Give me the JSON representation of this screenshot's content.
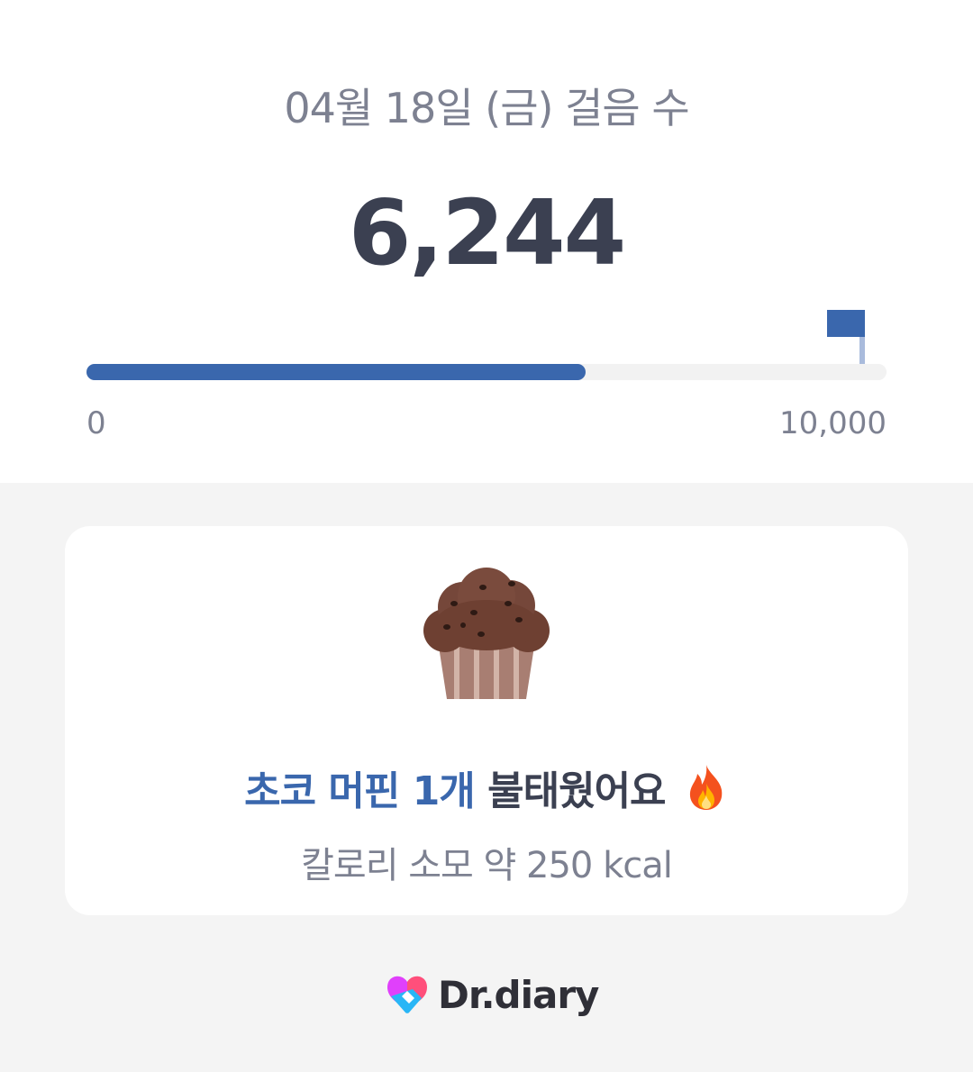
{
  "header": {
    "date_title": "04월 18일 (금) 걸음 수",
    "step_count": "6,244"
  },
  "progress": {
    "current": 6244,
    "goal": 10000,
    "min_label": "0",
    "max_label": "10,000",
    "fill_color": "#3a67ad",
    "track_color": "#f2f2f2"
  },
  "card": {
    "food_icon": "chocolate-muffin-icon",
    "burn_highlight": "초코 머핀 1개",
    "burn_suffix": "불태웠어요",
    "fire_icon": "fire-icon",
    "kcal_text": "칼로리 소모 약 250 kcal"
  },
  "footer": {
    "logo_text": "Dr.diary",
    "logo_icon": "heart-logo-icon"
  },
  "colors": {
    "accent": "#3a67ad",
    "text_dark": "#3b4051",
    "text_muted": "#7d8191",
    "background": "#f4f4f4"
  }
}
